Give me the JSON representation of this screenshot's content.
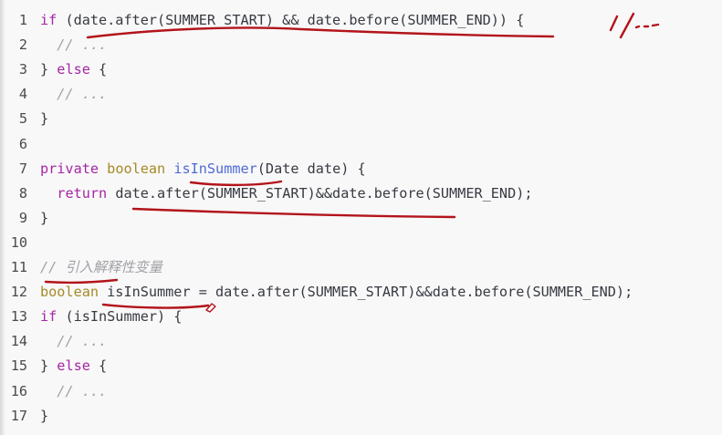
{
  "lines": [
    {
      "n": "1",
      "code": [
        {
          "t": "if",
          "c": "kw"
        },
        {
          "t": " (date.after(SUMMER_START) && date.before(SUMMER_END)) {"
        }
      ]
    },
    {
      "n": "2",
      "code": [
        {
          "t": "  // ...",
          "c": "cm"
        }
      ]
    },
    {
      "n": "3",
      "code": [
        {
          "t": "} "
        },
        {
          "t": "else",
          "c": "kw"
        },
        {
          "t": " {"
        }
      ]
    },
    {
      "n": "4",
      "code": [
        {
          "t": "  // ...",
          "c": "cm"
        }
      ]
    },
    {
      "n": "5",
      "code": [
        {
          "t": "}"
        }
      ]
    },
    {
      "n": "6",
      "code": []
    },
    {
      "n": "7",
      "code": [
        {
          "t": "private",
          "c": "kw"
        },
        {
          "t": " "
        },
        {
          "t": "boolean",
          "c": "ty"
        },
        {
          "t": " "
        },
        {
          "t": "isInSummer",
          "c": "fn"
        },
        {
          "t": "(Date date) {"
        }
      ]
    },
    {
      "n": "8",
      "code": [
        {
          "t": "  "
        },
        {
          "t": "return",
          "c": "kw"
        },
        {
          "t": " date.after(SUMMER_START)&&date.before(SUMMER_END);"
        }
      ]
    },
    {
      "n": "9",
      "code": [
        {
          "t": "}"
        }
      ]
    },
    {
      "n": "10",
      "code": []
    },
    {
      "n": "11",
      "code": [
        {
          "t": "// ",
          "c": "cm"
        },
        {
          "t": "引入解释性变量",
          "c": "cm cm-zh"
        }
      ]
    },
    {
      "n": "12",
      "code": [
        {
          "t": "boolean",
          "c": "ty"
        },
        {
          "t": " isInSummer = date.after(SUMMER_START)&&date.before(SUMMER_END);"
        }
      ]
    },
    {
      "n": "13",
      "code": [
        {
          "t": "if",
          "c": "kw"
        },
        {
          "t": " (isInSummer) {"
        }
      ]
    },
    {
      "n": "14",
      "code": [
        {
          "t": "  // ...",
          "c": "cm"
        }
      ]
    },
    {
      "n": "15",
      "code": [
        {
          "t": "} "
        },
        {
          "t": "else",
          "c": "kw"
        },
        {
          "t": " {"
        }
      ]
    },
    {
      "n": "16",
      "code": [
        {
          "t": "  // ...",
          "c": "cm"
        }
      ]
    },
    {
      "n": "17",
      "code": [
        {
          "t": "}"
        }
      ]
    }
  ],
  "annotation_color": "#b3141b"
}
